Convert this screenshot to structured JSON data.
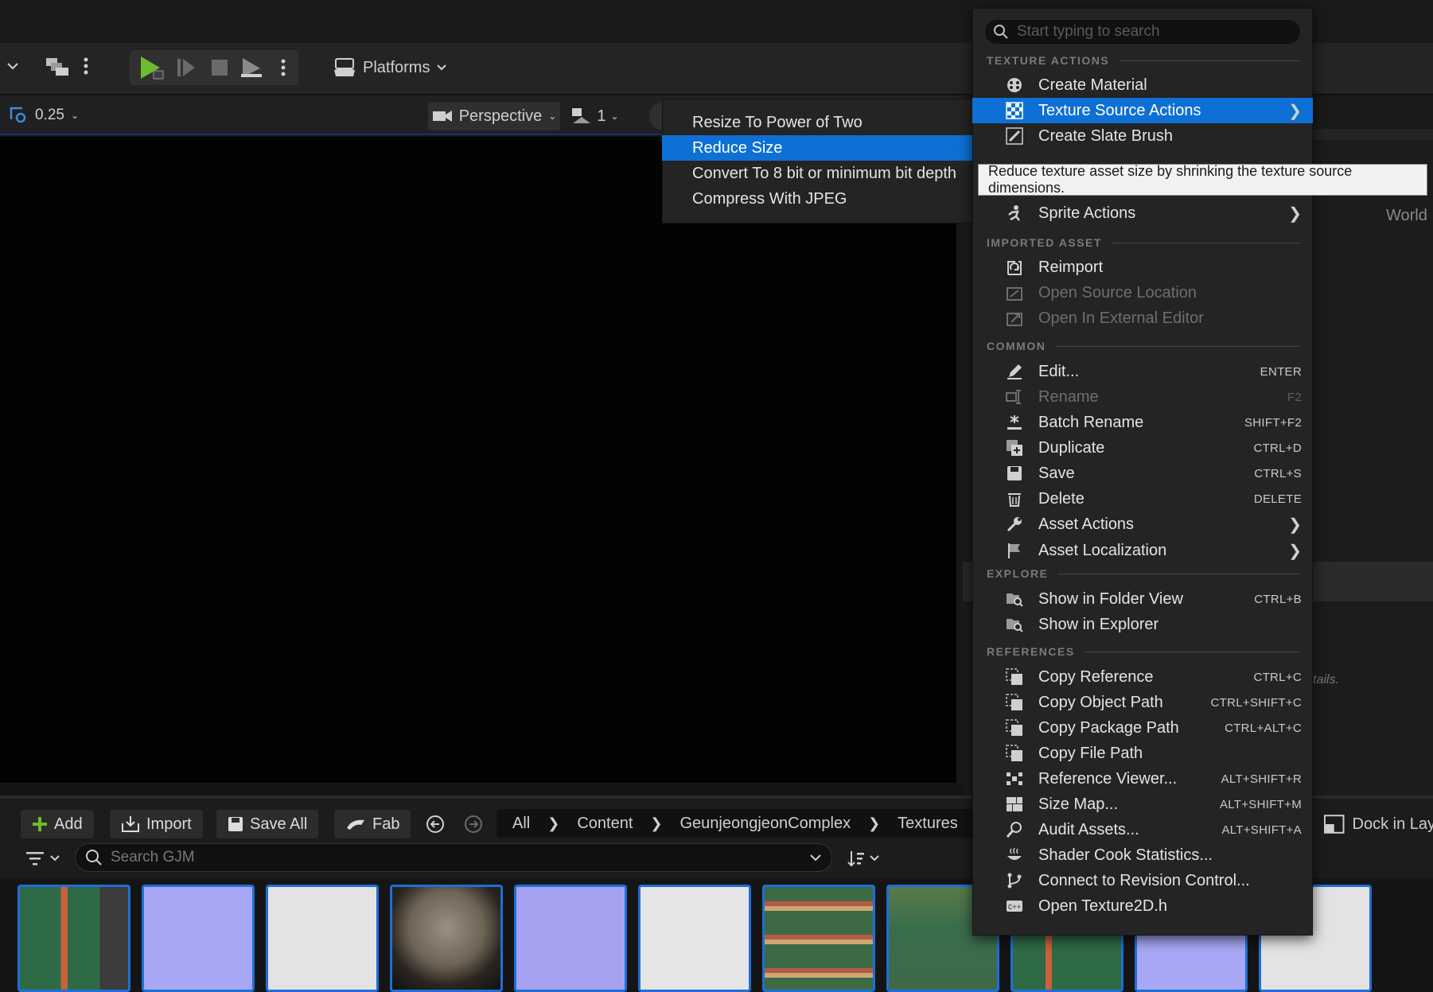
{
  "toolbar": {
    "platforms_label": "Platforms"
  },
  "viewport": {
    "zoom": "0.25",
    "view_mode": "Perspective",
    "layout_count": "1"
  },
  "right_panel": {
    "world_label": "World",
    "details_hint": "tails."
  },
  "submenu": {
    "items": [
      {
        "label": "Resize To Power of Two"
      },
      {
        "label": "Reduce Size"
      },
      {
        "label": "Convert To 8 bit or minimum bit depth"
      },
      {
        "label": "Compress With JPEG"
      }
    ]
  },
  "tooltip": "Reduce texture asset size by shrinking the texture source dimensions.",
  "menu": {
    "search_placeholder": "Start typing to search",
    "sections": {
      "texture_actions": "TEXTURE ACTIONS",
      "imported_asset": "IMPORTED ASSET",
      "common": "COMMON",
      "explore": "EXPLORE",
      "references": "REFERENCES"
    },
    "texture_actions": [
      {
        "label": "Create Material",
        "icon": "material-sphere-icon"
      },
      {
        "label": "Texture Source Actions",
        "icon": "texture-checker-icon",
        "submenu": true,
        "highlighted": true
      },
      {
        "label": "Create Slate Brush",
        "icon": "brush-icon"
      },
      {
        "label": "Sprite Actions",
        "icon": "sprite-icon",
        "submenu": true
      }
    ],
    "imported_asset": [
      {
        "label": "Reimport",
        "icon": "reimport-icon"
      },
      {
        "label": "Open Source Location",
        "icon": "open-location-icon",
        "disabled": true
      },
      {
        "label": "Open In External Editor",
        "icon": "external-editor-icon",
        "disabled": true
      }
    ],
    "common": [
      {
        "label": "Edit...",
        "shortcut": "ENTER",
        "icon": "pencil-icon"
      },
      {
        "label": "Rename",
        "shortcut": "F2",
        "icon": "rename-icon",
        "disabled": true
      },
      {
        "label": "Batch Rename",
        "shortcut": "SHIFT+F2",
        "icon": "batch-rename-icon"
      },
      {
        "label": "Duplicate",
        "shortcut": "CTRL+D",
        "icon": "duplicate-icon"
      },
      {
        "label": "Save",
        "shortcut": "CTRL+S",
        "icon": "save-icon"
      },
      {
        "label": "Delete",
        "shortcut": "DELETE",
        "icon": "trash-icon"
      },
      {
        "label": "Asset Actions",
        "icon": "wrench-icon",
        "submenu": true
      },
      {
        "label": "Asset Localization",
        "icon": "flag-icon",
        "submenu": true
      }
    ],
    "explore": [
      {
        "label": "Show in Folder View",
        "shortcut": "CTRL+B",
        "icon": "folder-search-icon"
      },
      {
        "label": "Show in Explorer",
        "icon": "folder-search-icon"
      }
    ],
    "references": [
      {
        "label": "Copy Reference",
        "shortcut": "CTRL+C",
        "icon": "copy-icon"
      },
      {
        "label": "Copy Object Path",
        "shortcut": "CTRL+SHIFT+C",
        "icon": "copy-icon"
      },
      {
        "label": "Copy Package Path",
        "shortcut": "CTRL+ALT+C",
        "icon": "copy-icon"
      },
      {
        "label": "Copy File Path",
        "icon": "copy-icon"
      },
      {
        "label": "Reference Viewer...",
        "shortcut": "ALT+SHIFT+R",
        "icon": "reference-viewer-icon"
      },
      {
        "label": "Size Map...",
        "shortcut": "ALT+SHIFT+M",
        "icon": "size-map-icon"
      },
      {
        "label": "Audit Assets...",
        "shortcut": "ALT+SHIFT+A",
        "icon": "audit-icon"
      },
      {
        "label": "Shader Cook Statistics...",
        "icon": "shader-icon"
      },
      {
        "label": "Connect to Revision Control...",
        "icon": "revision-control-icon"
      },
      {
        "label": "Open Texture2D.h",
        "icon": "code-file-icon"
      }
    ]
  },
  "content_browser": {
    "add_label": "Add",
    "import_label": "Import",
    "save_all_label": "Save All",
    "fab_label": "Fab",
    "breadcrumbs": [
      "All",
      "Content",
      "GeunjeongjeonComplex",
      "Textures"
    ],
    "search_placeholder": "Search GJM",
    "dock_label": "Dock in Lay"
  }
}
